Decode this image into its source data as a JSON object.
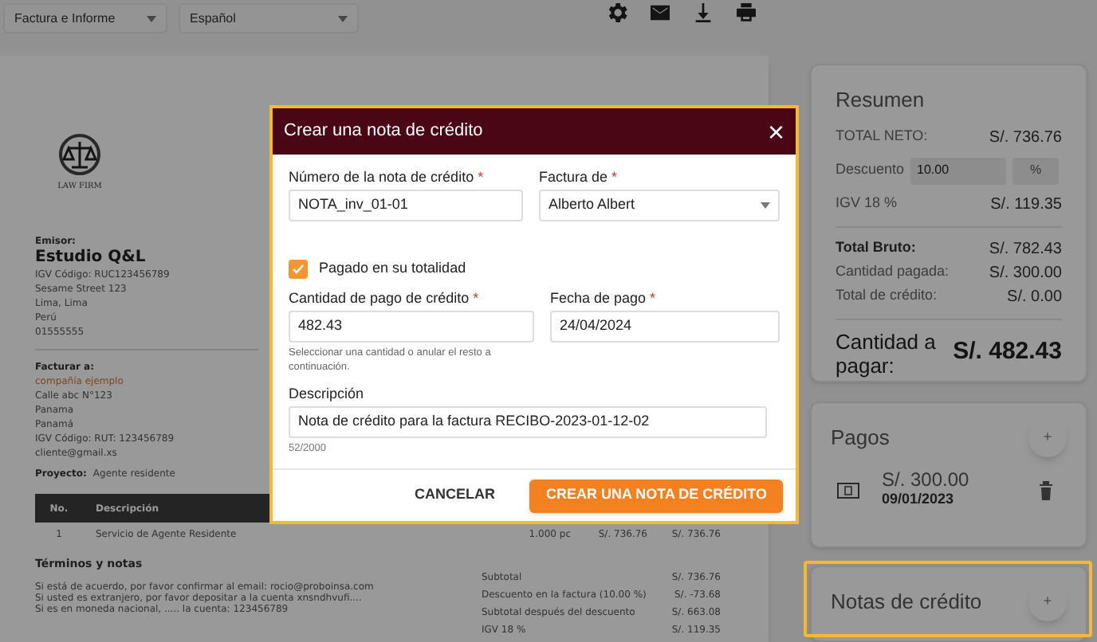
{
  "toolbar": {
    "selects": [
      {
        "value": "Factura e Informe"
      },
      {
        "value": "Español"
      }
    ]
  },
  "invoice": {
    "logo_text": "LAW FIRM",
    "issuer": {
      "label": "Emisor:",
      "name": "Estudio Q&L",
      "lines": [
        "IGV Código: RUC123456789",
        "Sesame Street 123",
        "Lima, Lima",
        "Perú",
        "01555555"
      ]
    },
    "bill_to": {
      "label": "Facturar a:",
      "company": "compañía ejemplo",
      "lines": [
        "Calle abc N°123",
        "Panama",
        "Panamá",
        "IGV Código: RUT: 123456789",
        "cliente@gmail.xs"
      ]
    },
    "project": {
      "label": "Proyecto:",
      "value": "Agente residente"
    },
    "table": {
      "columns": [
        "No.",
        "Descripción"
      ],
      "rows": [
        [
          "1",
          "Servicio de Agente Residente",
          "1.000 pc",
          "S/. 736.76",
          "S/. 736.76"
        ]
      ]
    },
    "terms": {
      "title": "Términos y notas",
      "lines": [
        "Si está de acuerdo, por favor confirmar al email: rocio@proboinsa.com",
        "Si usted es extranjero, por favor depositar a la cuenta xnsndhvufi....",
        "Si es en moneda nacional, ..... la cuenta: 123456789"
      ]
    },
    "totals": [
      {
        "label": "Subtotal",
        "value": "S/. 736.76"
      },
      {
        "label": "Descuento en la factura (10.00 %)",
        "value": "S/. -73.68"
      },
      {
        "label": "Subtotal después del descuento",
        "value": "S/. 663.08"
      },
      {
        "label": "IGV 18 %",
        "value": "S/. 119.35"
      }
    ]
  },
  "summary": {
    "title": "Resumen",
    "net": {
      "label": "TOTAL NETO:",
      "value": "S/. 736.76"
    },
    "discount": {
      "label": "Descuento",
      "value": "10.00",
      "unit": "%"
    },
    "tax": {
      "label": "IGV 18 %",
      "value": "S/. 119.35"
    },
    "rows": [
      {
        "label": "Total Bruto:",
        "value": "S/. 782.43",
        "bold": true
      },
      {
        "label": "Cantidad pagada:",
        "value": "S/. 300.00",
        "bold": false
      },
      {
        "label": "Total de crédito:",
        "value": "S/. 0.00",
        "bold": false
      }
    ],
    "due": {
      "label": "Cantidad a pagar:",
      "value": "S/. 482.43"
    }
  },
  "payments": {
    "title": "Pagos",
    "add": "+",
    "items": [
      {
        "amount": "S/. 300.00",
        "date": "09/01/2023"
      }
    ]
  },
  "credit_notes": {
    "title": "Notas de crédito",
    "add": "+",
    "highlighted": true
  },
  "dialog": {
    "title": "Crear una nota de crédito",
    "close": "×",
    "number": {
      "label": "Número de la nota de crédito",
      "required": "*",
      "value": "NOTA_inv_01-01"
    },
    "invoice_of": {
      "label": "Factura de",
      "required": "*",
      "value": "Alberto Albert"
    },
    "paid_in_full": {
      "label": "Pagado en su totalidad",
      "checked": true
    },
    "amount": {
      "label": "Cantidad de pago de crédito",
      "required": "*",
      "value": "482.43",
      "hint": "Seleccionar una cantidad o anular el resto a continuación."
    },
    "date": {
      "label": "Fecha de pago",
      "required": "*",
      "value": "24/04/2024"
    },
    "description": {
      "label": "Descripción",
      "value": "Nota de crédito para la factura RECIBO-2023-01-12-02",
      "counter": "52/2000"
    },
    "buttons": [
      {
        "label": "CANCELAR",
        "kind": "text"
      },
      {
        "label": "CREAR UNA NOTA DE CRÉDITO",
        "kind": "primary"
      }
    ]
  }
}
